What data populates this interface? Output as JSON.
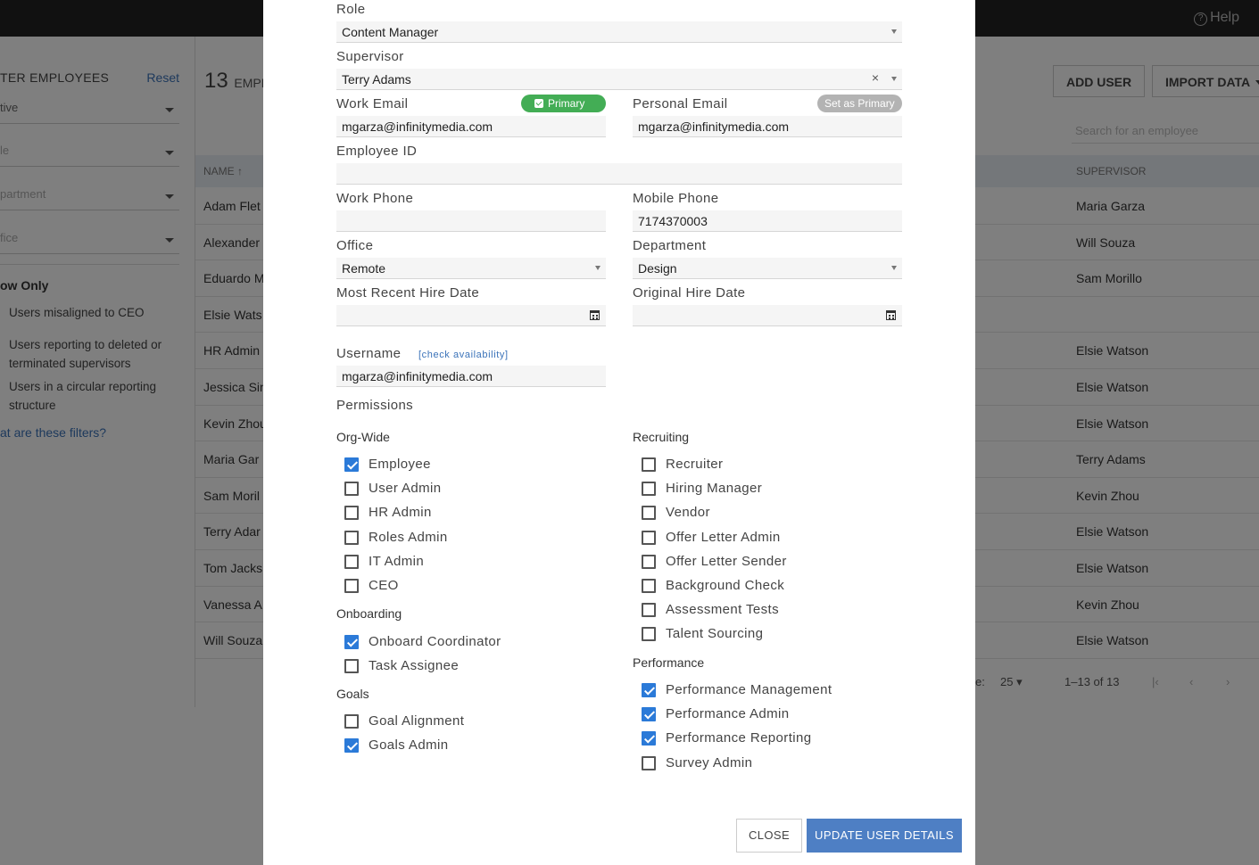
{
  "background": {
    "help_label": "Help",
    "filters": {
      "title": "TER EMPLOYEES",
      "reset": "Reset",
      "selects": [
        "tive",
        "le",
        "partment",
        "fice"
      ],
      "show_only": "ow Only",
      "options": [
        "Users misaligned to CEO",
        "Users reporting to deleted or terminated supervisors",
        "Users in a circular reporting structure"
      ],
      "what_link": "at are these filters?"
    },
    "count": "13",
    "count_suffix": "EMPL",
    "add_user": "ADD USER",
    "import_data": "IMPORT DATA",
    "search_placeholder": "Search for an employee",
    "col_name": "NAME",
    "col_supervisor": "SUPERVISOR",
    "rows": [
      {
        "name": "Adam Flet",
        "supervisor": "Maria Garza"
      },
      {
        "name": "Alexander",
        "supervisor": "Will Souza"
      },
      {
        "name": "Eduardo M",
        "supervisor": "Sam Morillo"
      },
      {
        "name": "Elsie Wats",
        "supervisor": ""
      },
      {
        "name": "HR Admin",
        "supervisor": "Elsie Watson"
      },
      {
        "name": "Jessica Sin",
        "supervisor": "Elsie Watson"
      },
      {
        "name": "Kevin Zhou",
        "supervisor": "Elsie Watson"
      },
      {
        "name": "Maria Gar",
        "supervisor": "Terry Adams"
      },
      {
        "name": "Sam Moril",
        "supervisor": "Kevin Zhou"
      },
      {
        "name": "Terry Adar",
        "supervisor": "Elsie Watson"
      },
      {
        "name": "Tom Jacks",
        "supervisor": "Elsie Watson"
      },
      {
        "name": "Vanessa A",
        "supervisor": "Kevin Zhou"
      },
      {
        "name": "Will Souza",
        "supervisor": "Elsie Watson"
      }
    ],
    "per_page_label": "e:",
    "per_page": "25",
    "range": "1–13 of 13"
  },
  "modal": {
    "role_label": "Role",
    "role_value": "Content Manager",
    "supervisor_label": "Supervisor",
    "supervisor_value": "Terry Adams",
    "work_email_label": "Work Email",
    "primary_badge": "Primary",
    "work_email_value": "mgarza@infinitymedia.com",
    "personal_email_label": "Personal Email",
    "set_primary": "Set as Primary",
    "personal_email_value": "mgarza@infinitymedia.com",
    "employee_id_label": "Employee ID",
    "employee_id_value": "",
    "work_phone_label": "Work Phone",
    "work_phone_value": "",
    "mobile_phone_label": "Mobile Phone",
    "mobile_phone_value": "7174370003",
    "office_label": "Office",
    "office_value": "Remote",
    "department_label": "Department",
    "department_value": "Design",
    "recent_hire_label": "Most Recent Hire Date",
    "original_hire_label": "Original Hire Date",
    "username_label": "Username",
    "check_availability": "[check availability]",
    "username_value": "mgarza@infinitymedia.com",
    "permissions_label": "Permissions",
    "groups": {
      "org_wide": {
        "title": "Org-Wide",
        "items": [
          {
            "label": "Employee",
            "checked": true
          },
          {
            "label": "User Admin",
            "checked": false
          },
          {
            "label": "HR Admin",
            "checked": false
          },
          {
            "label": "Roles Admin",
            "checked": false
          },
          {
            "label": "IT Admin",
            "checked": false
          },
          {
            "label": "CEO",
            "checked": false
          }
        ]
      },
      "onboarding": {
        "title": "Onboarding",
        "items": [
          {
            "label": "Onboard Coordinator",
            "checked": true
          },
          {
            "label": "Task Assignee",
            "checked": false
          }
        ]
      },
      "goals": {
        "title": "Goals",
        "items": [
          {
            "label": "Goal Alignment",
            "checked": false
          },
          {
            "label": "Goals Admin",
            "checked": true
          }
        ]
      },
      "recruiting": {
        "title": "Recruiting",
        "items": [
          {
            "label": "Recruiter",
            "checked": false
          },
          {
            "label": "Hiring Manager",
            "checked": false
          },
          {
            "label": "Vendor",
            "checked": false
          },
          {
            "label": "Offer Letter Admin",
            "checked": false
          },
          {
            "label": "Offer Letter Sender",
            "checked": false
          },
          {
            "label": "Background Check",
            "checked": false
          },
          {
            "label": "Assessment Tests",
            "checked": false
          },
          {
            "label": "Talent Sourcing",
            "checked": false
          }
        ]
      },
      "performance": {
        "title": "Performance",
        "items": [
          {
            "label": "Performance Management",
            "checked": true
          },
          {
            "label": "Performance Admin",
            "checked": true
          },
          {
            "label": "Performance Reporting",
            "checked": true
          },
          {
            "label": "Survey Admin",
            "checked": false
          }
        ]
      }
    },
    "close_label": "CLOSE",
    "update_label": "UPDATE USER DETAILS"
  }
}
